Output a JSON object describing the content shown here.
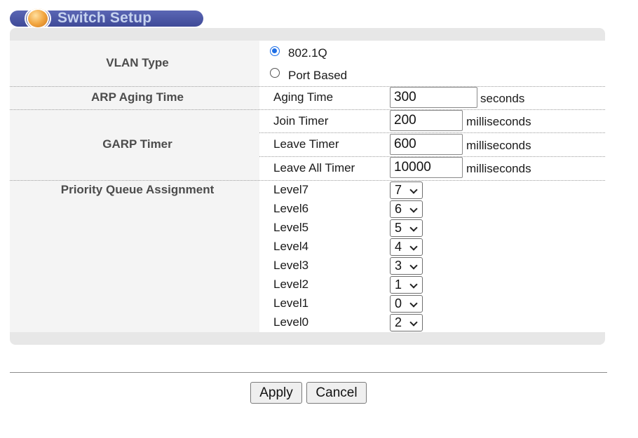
{
  "title": "Switch Setup",
  "vlan": {
    "label": "VLAN Type",
    "options": [
      {
        "label": "802.1Q",
        "checked": true
      },
      {
        "label": "Port Based",
        "checked": false
      }
    ]
  },
  "arp": {
    "label": "ARP Aging Time",
    "field_label": "Aging Time",
    "value": "300",
    "unit": "seconds"
  },
  "garp": {
    "label": "GARP Timer",
    "timers": [
      {
        "label": "Join Timer",
        "value": "200",
        "unit": "milliseconds"
      },
      {
        "label": "Leave Timer",
        "value": "600",
        "unit": "milliseconds"
      },
      {
        "label": "Leave All Timer",
        "value": "10000",
        "unit": "milliseconds"
      }
    ]
  },
  "priority": {
    "label": "Priority Queue Assignment",
    "levels": [
      {
        "label": "Level7",
        "value": "7"
      },
      {
        "label": "Level6",
        "value": "6"
      },
      {
        "label": "Level5",
        "value": "5"
      },
      {
        "label": "Level4",
        "value": "4"
      },
      {
        "label": "Level3",
        "value": "3"
      },
      {
        "label": "Level2",
        "value": "1"
      },
      {
        "label": "Level1",
        "value": "0"
      },
      {
        "label": "Level0",
        "value": "2"
      }
    ]
  },
  "buttons": {
    "apply": "Apply",
    "cancel": "Cancel"
  },
  "colors": {
    "banner": "#4a55a6",
    "banner_text": "#c6d3ef",
    "radio_accent": "#1d6ee6",
    "panel_bg": "#e7e7e7"
  }
}
